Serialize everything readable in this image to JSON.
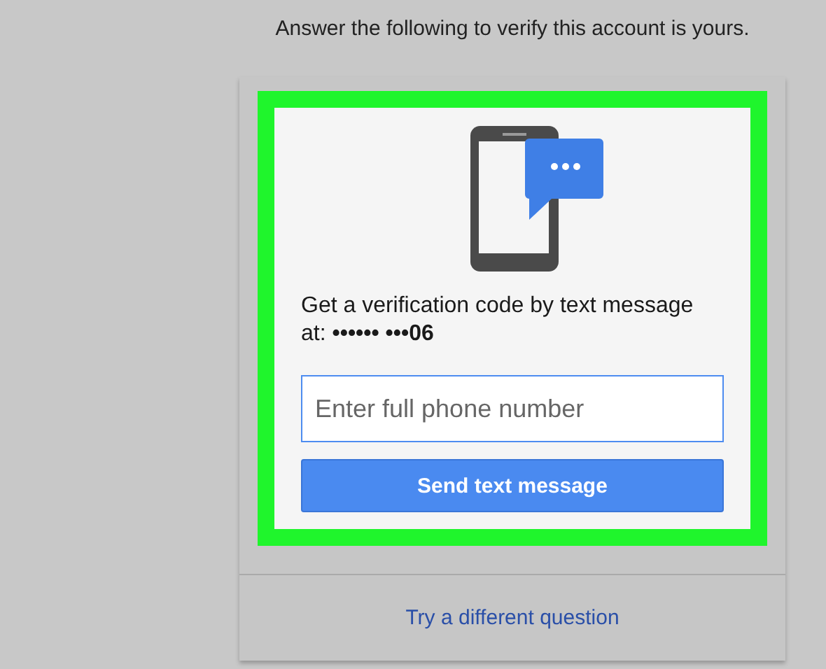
{
  "instruction": "Answer the following to verify this account is yours.",
  "prompt": "Get a verification code by text message at: **•••••• •••06**",
  "phone_field": {
    "placeholder": "Enter full phone number"
  },
  "send_button": "Send text message",
  "alternate_link": "Try a different question"
}
